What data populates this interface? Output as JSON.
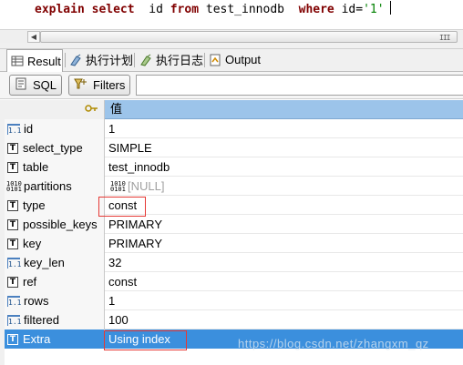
{
  "editor": {
    "kw_explain": "explain",
    "kw_select": "select",
    "col": "id",
    "kw_from": "from",
    "table": "test_innodb",
    "kw_where": "where",
    "cond": "id=",
    "value": "'1'"
  },
  "tabs": [
    {
      "label": "Result",
      "icon": "result-grid-icon"
    },
    {
      "label": "执行计划",
      "icon": "execution-plan-icon"
    },
    {
      "label": "执行日志",
      "icon": "execution-log-icon"
    },
    {
      "label": "Output",
      "icon": "output-icon"
    }
  ],
  "toolbar": {
    "sql_label": "SQL",
    "filters_label": "Filters"
  },
  "grid": {
    "value_header": "值",
    "rows": [
      {
        "name": "id",
        "type_icon": "numeric",
        "value": "1"
      },
      {
        "name": "select_type",
        "type_icon": "text",
        "value": "SIMPLE"
      },
      {
        "name": "table",
        "type_icon": "text",
        "value": "test_innodb"
      },
      {
        "name": "partitions",
        "type_icon": "binary",
        "value": "[NULL]"
      },
      {
        "name": "type",
        "type_icon": "text",
        "value": "const"
      },
      {
        "name": "possible_keys",
        "type_icon": "text",
        "value": "PRIMARY"
      },
      {
        "name": "key",
        "type_icon": "text",
        "value": "PRIMARY"
      },
      {
        "name": "key_len",
        "type_icon": "numeric",
        "value": "32"
      },
      {
        "name": "ref",
        "type_icon": "text",
        "value": "const"
      },
      {
        "name": "rows",
        "type_icon": "numeric",
        "value": "1"
      },
      {
        "name": "filtered",
        "type_icon": "numeric",
        "value": "100"
      },
      {
        "name": "Extra",
        "type_icon": "text",
        "value": "Using index"
      }
    ]
  },
  "watermark": "https://blog.csdn.net/zhangxm_qz",
  "colors": {
    "selection": "#3b8fdd",
    "header": "#9cc4ea",
    "highlight_box": "#e53935",
    "keyword": "#800000",
    "string": "#008000"
  }
}
